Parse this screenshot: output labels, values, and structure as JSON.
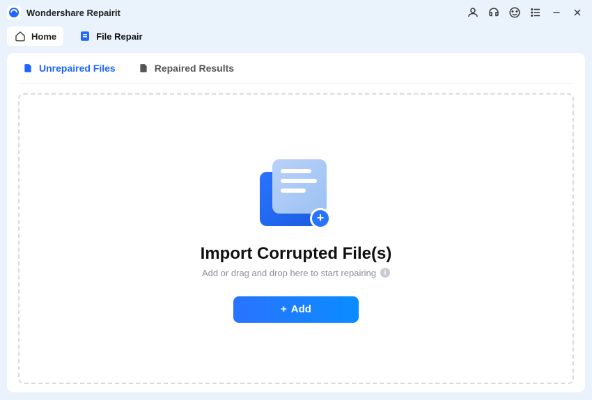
{
  "app": {
    "title": "Wondershare Repairit"
  },
  "tabs": {
    "home": "Home",
    "file_repair": "File Repair"
  },
  "subtabs": {
    "unrepaired": "Unrepaired Files",
    "repaired": "Repaired Results"
  },
  "dropzone": {
    "heading": "Import Corrupted File(s)",
    "subtext": "Add or drag and drop here to start repairing",
    "add_button": "Add"
  }
}
